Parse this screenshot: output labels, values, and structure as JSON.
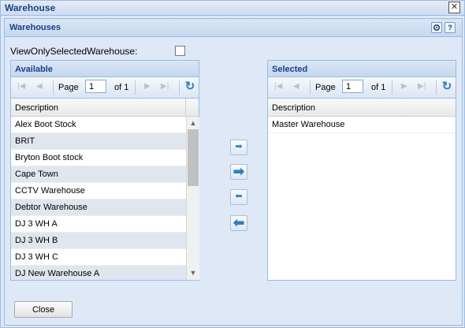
{
  "window": {
    "title": "Warehouse",
    "close_glyph": "✕"
  },
  "panel": {
    "title": "Warehouses",
    "tool_gear_icon": "gear-icon",
    "tool_help_glyph": "?"
  },
  "view_only": {
    "label": "ViewOnlySelectedWarehouse:",
    "checked": false
  },
  "available": {
    "title": "Available",
    "pager": {
      "page_label": "Page",
      "page_value": "1",
      "of_label": "of 1"
    },
    "column": "Description",
    "rows": [
      "Alex Boot Stock",
      "BRIT",
      "Bryton Boot stock",
      "Cape Town",
      "CCTV Warehouse",
      "Debtor Warehouse",
      "DJ 3 WH A",
      "DJ 3 WH B",
      "DJ 3 WH C",
      "DJ New Warehouse A"
    ]
  },
  "selected": {
    "title": "Selected",
    "pager": {
      "page_label": "Page",
      "page_value": "1",
      "of_label": "of 1"
    },
    "column": "Description",
    "rows": [
      "Master Warehouse"
    ]
  },
  "buttons": {
    "close": "Close"
  },
  "colors": {
    "accent": "#15428b",
    "border": "#99bbe8",
    "panel_bg": "#dfe8f6",
    "alt_row": "#e0e6f0"
  }
}
